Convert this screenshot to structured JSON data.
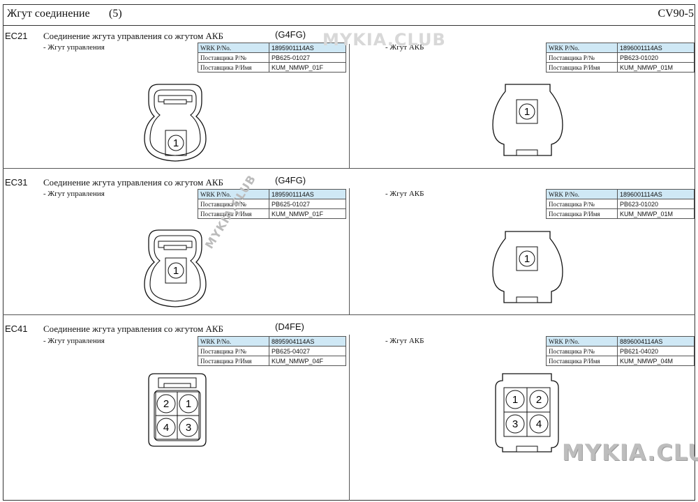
{
  "header": {
    "title": "Жгут соединение",
    "part": "(5)",
    "code": "CV90-5"
  },
  "sections": [
    {
      "id": "EC21",
      "title": "Соединение жгута управления со жгутом АКБ",
      "engine": "(G4FG)",
      "left": {
        "label": "- Жгут управления",
        "wrk_label": "WRK P/No.",
        "wrk": "1895901114AS",
        "supplier_label": "Поставщика P/№",
        "supplier": "PB625-01027",
        "name_label": "Поставщика P/Имя",
        "name": "KUM_NMWP_01F",
        "pins": [
          "1"
        ]
      },
      "right": {
        "label": "- Жгут АКБ",
        "wrk_label": "WRK P/No.",
        "wrk": "1896001114AS",
        "supplier_label": "Поставщика P/№",
        "supplier": "PB623-01020",
        "name_label": "Поставщика P/Имя",
        "name": "KUM_NMWP_01M",
        "pins": [
          "1"
        ]
      }
    },
    {
      "id": "EC31",
      "title": "Соединение жгута управления со жгутом АКБ",
      "engine": "(G4FG)",
      "left": {
        "label": "- Жгут управления",
        "wrk_label": "WRK P/No.",
        "wrk": "1895901114AS",
        "supplier_label": "Поставщика P/№",
        "supplier": "PB625-01027",
        "name_label": "Поставщика P/Имя",
        "name": "KUM_NMWP_01F",
        "pins": [
          "1"
        ]
      },
      "right": {
        "label": "- Жгут АКБ",
        "wrk_label": "WRK P/No.",
        "wrk": "1896001114AS",
        "supplier_label": "Поставщика P/№",
        "supplier": "PB623-01020",
        "name_label": "Поставщика P/Имя",
        "name": "KUM_NMWP_01M",
        "pins": [
          "1"
        ]
      }
    },
    {
      "id": "EC41",
      "title": "Соединение жгута управления со жгутом АКБ",
      "engine": "(D4FE)",
      "left": {
        "label": "- Жгут управления",
        "wrk_label": "WRK P/No.",
        "wrk": "8895904114AS",
        "supplier_label": "Поставщика P/№",
        "supplier": "PB625-04027",
        "name_label": "Поставщика P/Имя",
        "name": "KUM_NMWP_04F",
        "pins": [
          "2",
          "1",
          "4",
          "3"
        ]
      },
      "right": {
        "label": "- Жгут АКБ",
        "wrk_label": "WRK P/No.",
        "wrk": "8896004114AS",
        "supplier_label": "Поставщика P/№",
        "supplier": "PB621-04020",
        "name_label": "Поставщика P/Имя",
        "name": "KUM_NMWP_04M",
        "pins": [
          "1",
          "2",
          "3",
          "4"
        ]
      }
    }
  ],
  "watermarks": [
    "MYKIA.CLUB",
    "MYKIA.CLUB",
    "MYKIA.CLUB"
  ],
  "colors": {
    "table_highlight": "#cfe8f5",
    "line": "#333333"
  }
}
